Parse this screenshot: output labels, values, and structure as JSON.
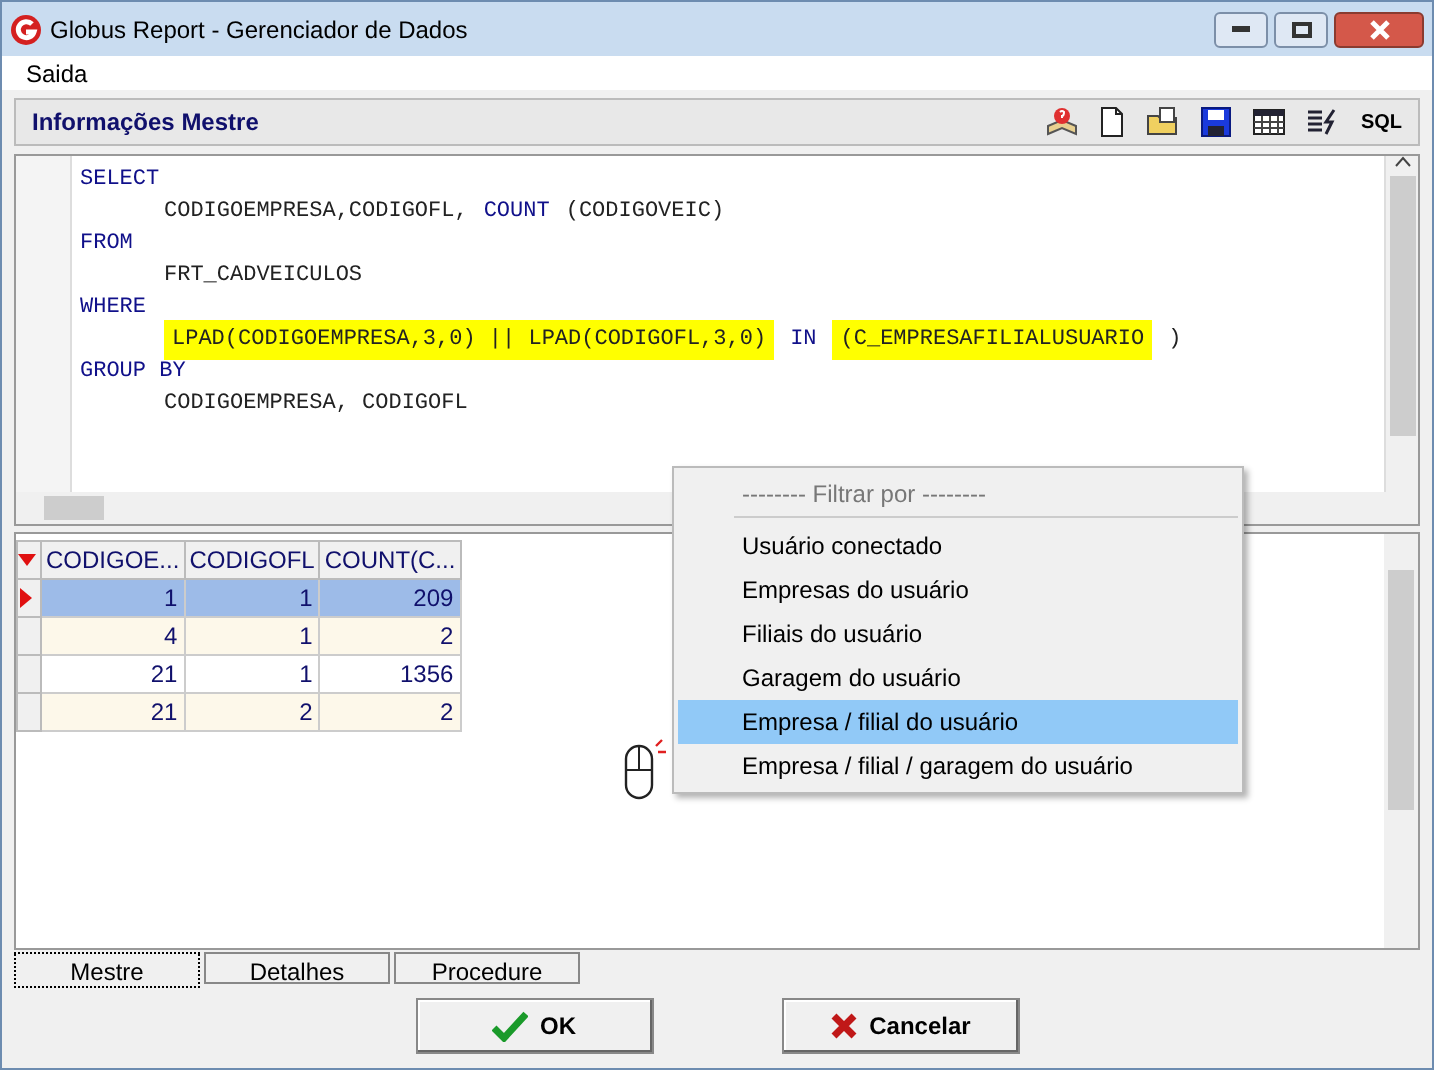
{
  "window": {
    "title": "Globus Report - Gerenciador de Dados"
  },
  "menu_bar": [
    "Saida"
  ],
  "panel": {
    "title": "Informações Mestre",
    "toolbar": [
      {
        "kind": "help"
      },
      {
        "kind": "new"
      },
      {
        "kind": "open"
      },
      {
        "kind": "save"
      },
      {
        "kind": "grid"
      },
      {
        "kind": "run"
      },
      {
        "kind": "sql",
        "label": "SQL"
      }
    ]
  },
  "sql_lines": [
    {
      "indented": false,
      "tokens": [
        {
          "text": "SELECT",
          "kind": "keyword",
          "highlight": false
        }
      ]
    },
    {
      "indented": true,
      "tokens": [
        {
          "text": "CODIGOEMPRESA,CODIGOFL,",
          "kind": "ident",
          "highlight": false
        },
        {
          "text": "COUNT",
          "kind": "keyword",
          "highlight": false
        },
        {
          "text": "(CODIGOVEIC)",
          "kind": "ident",
          "highlight": false
        }
      ]
    },
    {
      "indented": false,
      "tokens": [
        {
          "text": "FROM",
          "kind": "keyword",
          "highlight": false
        }
      ]
    },
    {
      "indented": true,
      "tokens": [
        {
          "text": "FRT_CADVEICULOS",
          "kind": "ident",
          "highlight": false
        }
      ]
    },
    {
      "indented": false,
      "tokens": [
        {
          "text": "WHERE",
          "kind": "keyword",
          "highlight": false
        }
      ]
    },
    {
      "indented": true,
      "tokens": [
        {
          "text": "LPAD(CODIGOEMPRESA,3,0) || LPAD(CODIGOFL,3,0)",
          "kind": "ident",
          "highlight": true
        },
        {
          "text": "IN",
          "kind": "keyword",
          "highlight": false
        },
        {
          "text": "(C_EMPRESAFILIALUSUARIO",
          "kind": "ident",
          "highlight": true
        },
        {
          "text": ")",
          "kind": "ident",
          "highlight": false
        }
      ]
    },
    {
      "indented": false,
      "tokens": [
        {
          "text": "GROUP BY",
          "kind": "keyword",
          "highlight": false
        }
      ]
    },
    {
      "indented": true,
      "tokens": [
        {
          "text": "CODIGOEMPRESA, CODIGOFL",
          "kind": "ident",
          "highlight": false
        }
      ]
    }
  ],
  "table": {
    "columns": [
      "CODIGOE...",
      "CODIGOFL",
      "COUNT(C..."
    ],
    "rows": [
      {
        "selected": true,
        "cells": [
          "1",
          "1",
          "209"
        ]
      },
      {
        "selected": false,
        "cells": [
          "4",
          "1",
          "2"
        ]
      },
      {
        "selected": false,
        "cells": [
          "21",
          "1",
          "1356"
        ]
      },
      {
        "selected": false,
        "cells": [
          "21",
          "2",
          "2"
        ]
      }
    ]
  },
  "context_menu": {
    "header": "-------- Filtrar por --------",
    "items": [
      {
        "label": "Usuário conectado",
        "selected": false
      },
      {
        "label": "Empresas do usuário",
        "selected": false
      },
      {
        "label": "Filiais do usuário",
        "selected": false
      },
      {
        "label": "Garagem do usuário",
        "selected": false
      },
      {
        "label": "Empresa / filial do usuário",
        "selected": true
      },
      {
        "label": "Empresa / filial / garagem do usuário",
        "selected": false
      }
    ]
  },
  "tabs": [
    {
      "label": "Mestre",
      "selected": true
    },
    {
      "label": "Detalhes",
      "selected": false
    },
    {
      "label": "Procedure",
      "selected": false
    }
  ],
  "buttons": [
    {
      "kind": "ok",
      "label": "OK"
    },
    {
      "kind": "cancel",
      "label": "Cancelar"
    }
  ]
}
